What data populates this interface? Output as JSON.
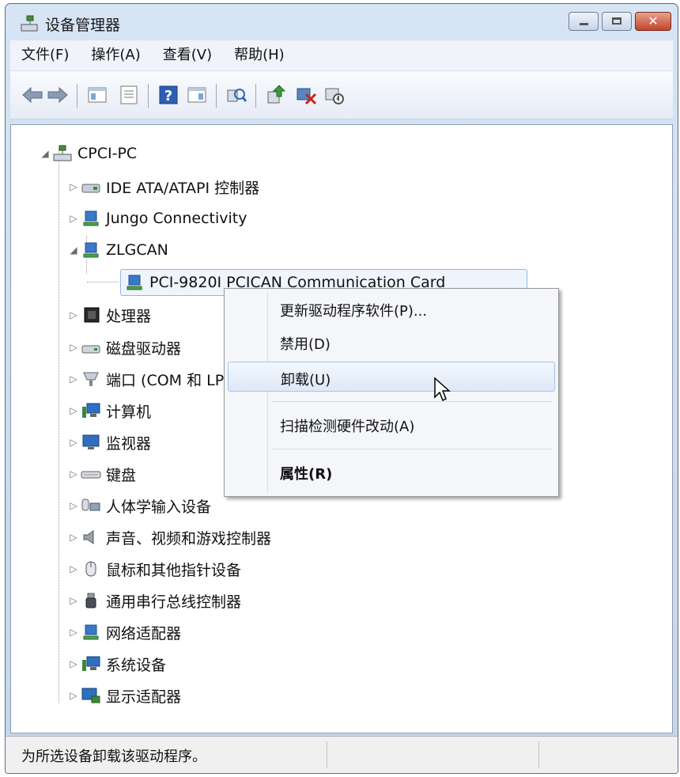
{
  "window": {
    "title": "设备管理器",
    "controls": {
      "minimize": "minimize",
      "maximize": "maximize",
      "close": "✕"
    }
  },
  "menu": [
    "文件(F)",
    "操作(A)",
    "查看(V)",
    "帮助(H)"
  ],
  "toolbar": {
    "buttons": [
      "back-icon",
      "forward-icon",
      "show-hide-console-tree-icon",
      "properties-icon",
      "help-icon",
      "action-pane-icon",
      "scan-hardware-icon",
      "update-driver-icon",
      "uninstall-device-icon",
      "disable-device-icon"
    ]
  },
  "tree": {
    "root": "CPCI-PC",
    "items": [
      {
        "label": "IDE ATA/ATAPI 控制器",
        "icon": "ide-controller-icon",
        "expanded": false
      },
      {
        "label": "Jungo Connectivity",
        "icon": "network-device-icon",
        "expanded": false
      },
      {
        "label": "ZLGCAN",
        "icon": "network-device-icon",
        "expanded": true
      },
      {
        "label": "PCI-9820I PCICAN Communication Card",
        "icon": "network-device-icon",
        "child": true,
        "selected": true
      },
      {
        "label": "处理器",
        "icon": "processor-icon",
        "expanded": false
      },
      {
        "label": "磁盘驱动器",
        "icon": "disk-drive-icon",
        "expanded": false
      },
      {
        "label": "端口 (COM 和 LPT)",
        "icon": "port-icon",
        "expanded": false
      },
      {
        "label": "计算机",
        "icon": "computer-icon",
        "expanded": false
      },
      {
        "label": "监视器",
        "icon": "monitor-icon",
        "expanded": false
      },
      {
        "label": "键盘",
        "icon": "keyboard-icon",
        "expanded": false
      },
      {
        "label": "人体学输入设备",
        "icon": "hid-icon",
        "expanded": false
      },
      {
        "label": "声音、视频和游戏控制器",
        "icon": "speaker-icon",
        "expanded": false
      },
      {
        "label": "鼠标和其他指针设备",
        "icon": "mouse-icon",
        "expanded": false
      },
      {
        "label": "通用串行总线控制器",
        "icon": "usb-icon",
        "expanded": false
      },
      {
        "label": "网络适配器",
        "icon": "network-adapter-icon",
        "expanded": false
      },
      {
        "label": "系统设备",
        "icon": "system-device-icon",
        "expanded": false
      },
      {
        "label": "显示适配器",
        "icon": "display-adapter-icon",
        "expanded": false
      }
    ]
  },
  "context_menu": {
    "items": [
      "更新驱动程序软件(P)...",
      "禁用(D)",
      "卸载(U)",
      "扫描检测硬件改动(A)",
      "属性(R)"
    ],
    "hovered": "卸载(U)",
    "default_item": "属性(R)"
  },
  "status": {
    "text": "为所选设备卸载该驱动程序。"
  },
  "colors": {
    "window_frame": "#c4d6ec",
    "selection": "#8fb7e6",
    "close_button": "#c3442a"
  }
}
